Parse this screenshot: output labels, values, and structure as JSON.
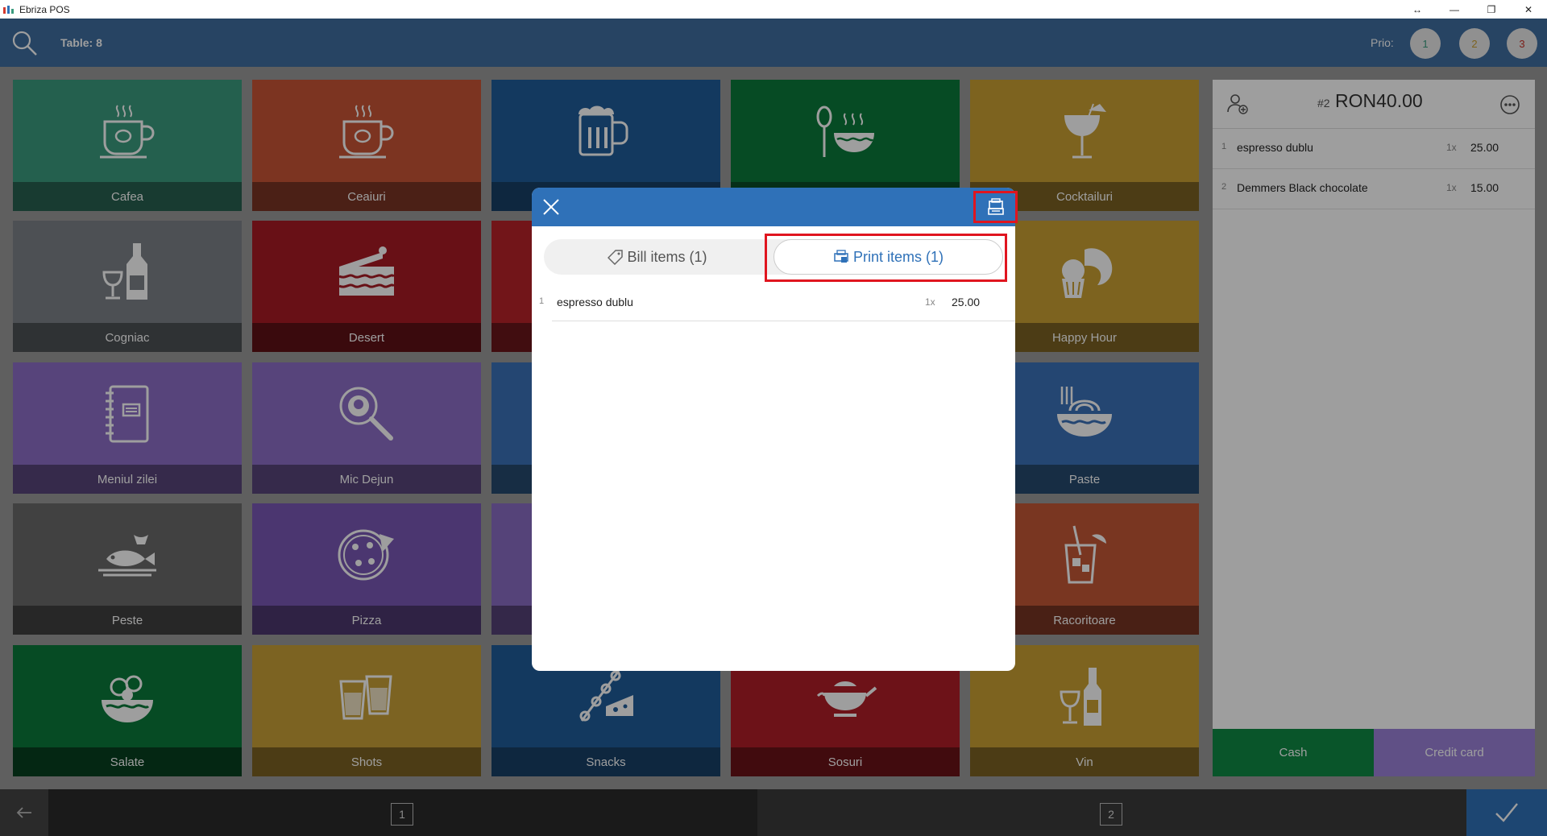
{
  "window": {
    "title": "Ebriza POS",
    "controls": [
      "↔",
      "—",
      "❐",
      "✕"
    ]
  },
  "topbar": {
    "table": "Table: 8",
    "prio_label": "Prio:",
    "prio": [
      "1",
      "2",
      "3"
    ]
  },
  "tiles": [
    {
      "label": "Cafea",
      "icon": "coffee-cup-icon",
      "color": "#3a9b7e",
      "band": "#275f4f"
    },
    {
      "label": "Ceaiuri",
      "icon": "tea-cup-icon",
      "color": "#c85536",
      "band": "#7a3524"
    },
    {
      "label": "",
      "icon": "beer-mug-icon",
      "color": "#1f5c99",
      "band": "#173f66"
    },
    {
      "label": "",
      "icon": "soup-bowl-icon",
      "color": "#0b7a3a",
      "band": "#0a4d27"
    },
    {
      "label": "Cocktailuri",
      "icon": "cocktail-glass-icon",
      "color": "#caa032",
      "band": "#7b6223"
    },
    {
      "label": "Cogniac",
      "icon": "cognac-bottle-icon",
      "color": "#7d8288",
      "band": "#4d5155"
    },
    {
      "label": "Desert",
      "icon": "cake-slice-icon",
      "color": "#a81b24",
      "band": "#5e1116"
    },
    {
      "label": "",
      "icon": "",
      "color": "#b82329",
      "band": "#6a161a"
    },
    {
      "label": "",
      "icon": "",
      "color": "#2f63a6",
      "band": "#1f4068"
    },
    {
      "label": "Happy Hour",
      "icon": "croissant-icon",
      "color": "#caa032",
      "band": "#7b6223"
    },
    {
      "label": "Meniul zilei",
      "icon": "menu-book-icon",
      "color": "#8d6ec7",
      "band": "#574579"
    },
    {
      "label": "Mic Dejun",
      "icon": "frying-pan-icon",
      "color": "#8d6ec7",
      "band": "#574579"
    },
    {
      "label": "",
      "icon": "",
      "color": "#3a71b8",
      "band": "#26496f"
    },
    {
      "label": "",
      "icon": "",
      "color": "#3a71b8",
      "band": "#26496f"
    },
    {
      "label": "Paste",
      "icon": "pasta-bowl-icon",
      "color": "#3a71b8",
      "band": "#26496f"
    },
    {
      "label": "Peste",
      "icon": "fish-plate-icon",
      "color": "#6a6a6a",
      "band": "#404040"
    },
    {
      "label": "Pizza",
      "icon": "pizza-icon",
      "color": "#7a58b5",
      "band": "#4c386e"
    },
    {
      "label": "",
      "icon": "",
      "color": "#8a6cc3",
      "band": "#554277"
    },
    {
      "label": "",
      "icon": "",
      "color": "#c45736",
      "band": "#763522"
    },
    {
      "label": "Racoritoare",
      "icon": "soft-drink-icon",
      "color": "#c45736",
      "band": "#763522"
    },
    {
      "label": "Salate",
      "icon": "salad-bowl-icon",
      "color": "#0b7a3a",
      "band": "#073f20"
    },
    {
      "label": "Shots",
      "icon": "shot-glasses-icon",
      "color": "#c8a038",
      "band": "#7b6223"
    },
    {
      "label": "Snacks",
      "icon": "skewer-cheese-icon",
      "color": "#1f5c99",
      "band": "#173f66"
    },
    {
      "label": "Sosuri",
      "icon": "gravy-boat-icon",
      "color": "#b01e27",
      "band": "#6a1218"
    },
    {
      "label": "Vin",
      "icon": "wine-bottle-icon",
      "color": "#caa032",
      "band": "#7b6223"
    }
  ],
  "order": {
    "number": "#2",
    "total": "RON40.00",
    "items": [
      {
        "idx": "1",
        "name": "espresso dublu",
        "qty": "1x",
        "price": "25.00"
      },
      {
        "idx": "2",
        "name": "Demmers Black chocolate",
        "qty": "1x",
        "price": "15.00"
      }
    ],
    "cash": "Cash",
    "card": "Credit card"
  },
  "bottom": {
    "pages": [
      "1",
      "2"
    ]
  },
  "modal": {
    "tab_bill": "Bill items (1)",
    "tab_print": "Print items (1)",
    "items": [
      {
        "idx": "1",
        "name": "espresso dublu",
        "qty": "1x",
        "price": "25.00"
      }
    ]
  },
  "colors": {
    "accent": "#2f71b8",
    "highlight": "#e0151f",
    "cash": "#0f8a45",
    "card": "#9b82d8"
  }
}
